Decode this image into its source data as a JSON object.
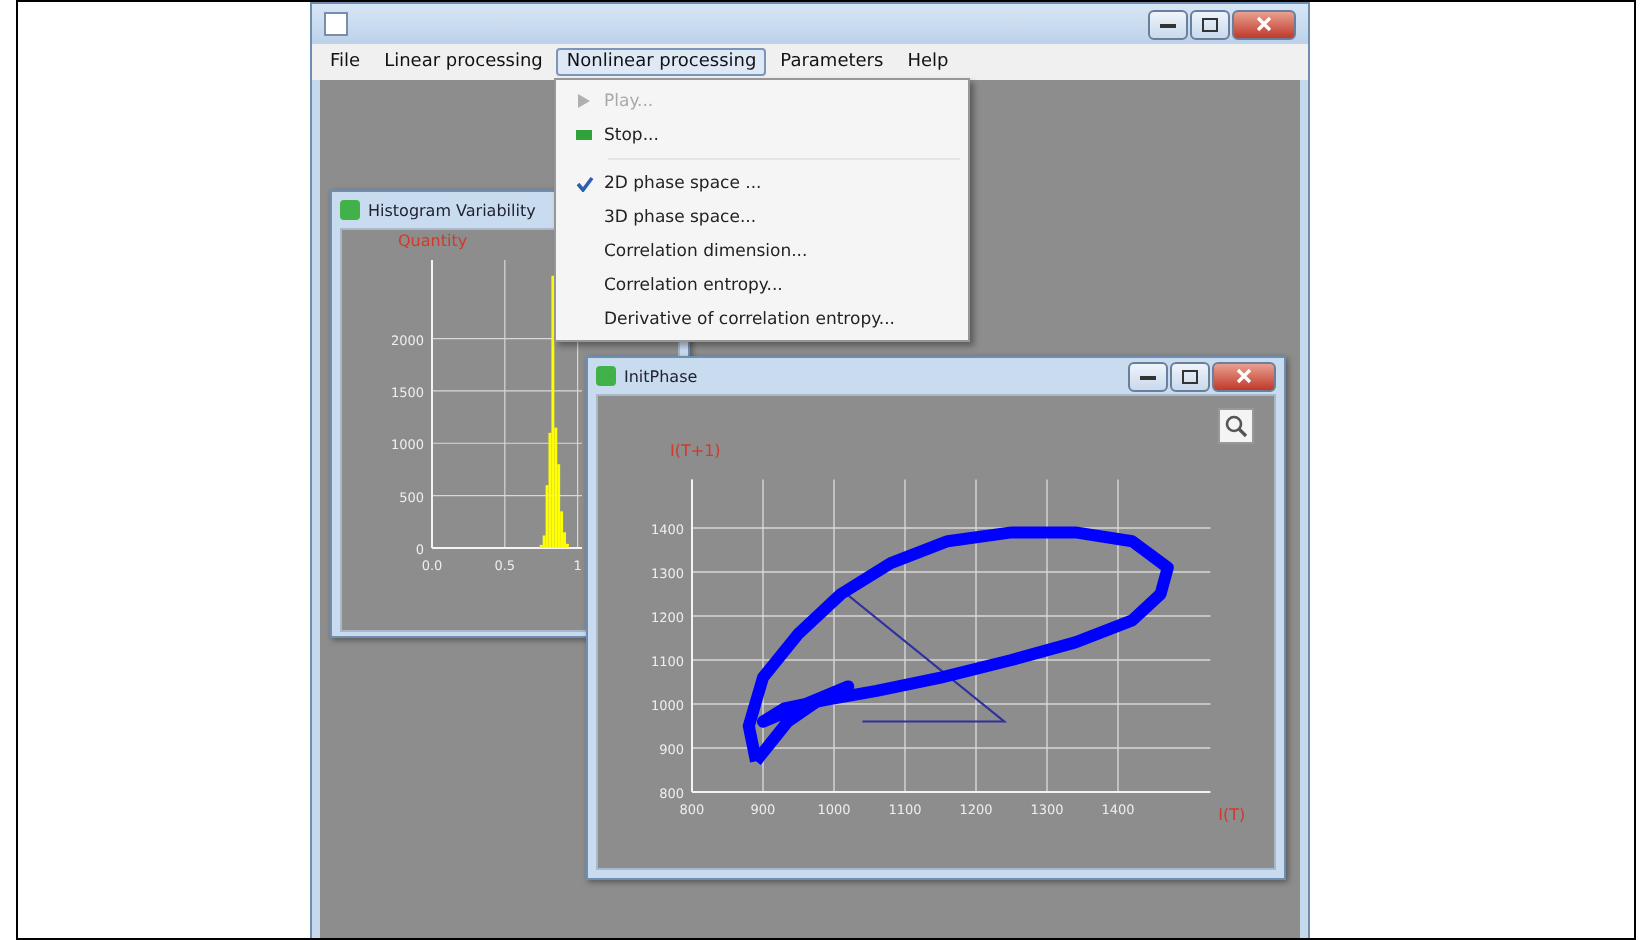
{
  "menu_bar": [
    {
      "label": "File",
      "selected": false
    },
    {
      "label": "Linear processing",
      "selected": false
    },
    {
      "label": "Nonlinear processing",
      "selected": true
    },
    {
      "label": "Parameters",
      "selected": false
    },
    {
      "label": "Help",
      "selected": false
    }
  ],
  "menu": {
    "items": [
      {
        "kind": "play",
        "label": "Play...",
        "disabled": true,
        "checked": false
      },
      {
        "kind": "stop",
        "label": "Stop...",
        "disabled": false,
        "checked": false
      },
      {
        "kind": "option",
        "label": "2D phase space ...",
        "disabled": false,
        "checked": true,
        "separator_before": true
      },
      {
        "kind": "option",
        "label": "3D phase space...",
        "disabled": false,
        "checked": false
      },
      {
        "kind": "option",
        "label": "Correlation dimension...",
        "disabled": false,
        "checked": false
      },
      {
        "kind": "option",
        "label": "Correlation entropy...",
        "disabled": false,
        "checked": false
      },
      {
        "kind": "option",
        "label": "Derivative of correlation entropy...",
        "disabled": false,
        "checked": false
      }
    ]
  },
  "histogram_window": {
    "title": "Histogram Variability",
    "chart_data": {
      "type": "bar",
      "ylabel": "Quantity",
      "grid": true,
      "x": [
        0.74,
        0.76,
        0.78,
        0.8,
        0.82,
        0.84,
        0.86,
        0.88,
        0.9,
        0.92
      ],
      "series": [
        {
          "color": "#ffff00",
          "values": [
            30,
            120,
            600,
            1100,
            2600,
            1150,
            800,
            350,
            150,
            40
          ]
        }
      ],
      "xlim": [
        0,
        1.03
      ],
      "ylim": [
        0,
        2750
      ],
      "xticks": [
        {
          "value": 0,
          "label": "0.0"
        },
        {
          "value": 0.5,
          "label": "0.5"
        },
        {
          "value": 1,
          "label": "1"
        }
      ],
      "yticks": [
        0,
        500,
        1000,
        1500,
        2000
      ]
    }
  },
  "phase_window": {
    "title": "InitPhase",
    "plot": {
      "xlabel": "I(T)",
      "ylabel": "I(T+1)",
      "xticks": [
        "800",
        "900",
        "1000",
        "1100",
        "1200",
        "1300",
        "1400"
      ],
      "yticks": [
        "1400",
        "1300",
        "1200",
        "1100",
        "1000",
        "900",
        "800"
      ]
    }
  }
}
